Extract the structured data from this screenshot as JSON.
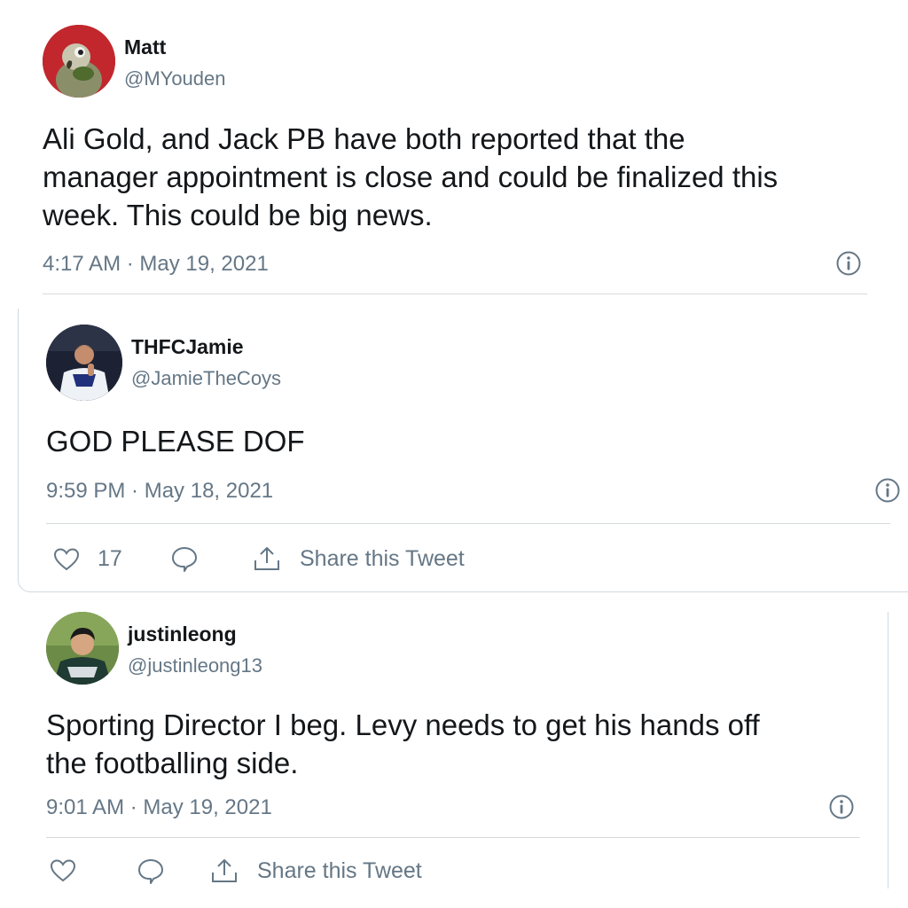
{
  "tweets": [
    {
      "author": "Matt",
      "handle": "@MYouden",
      "text_lines": [
        "Ali Gold, and Jack PB have both reported that the",
        "manager appointment is close and could be finalized this",
        "week. This could be big news."
      ],
      "timestamp": "4:17 AM · May 19, 2021",
      "avatar_icon": "parrot-avatar"
    },
    {
      "author": "THFCJamie",
      "handle": "@JamieTheCoys",
      "text_lines": [
        "GOD PLEASE DOF"
      ],
      "timestamp": "9:59 PM · May 18, 2021",
      "likes": "17",
      "share_label": "Share this Tweet",
      "avatar_icon": "footballer-avatar"
    },
    {
      "author": "justinleong",
      "handle": "@justinleong13",
      "text_lines": [
        "Sporting Director I beg. Levy needs to get his hands off",
        "the footballing side."
      ],
      "timestamp": "9:01 AM · May 19, 2021",
      "share_label": "Share this Tweet",
      "avatar_icon": "footballer-avatar"
    }
  ],
  "colors": {
    "text": "#14171a",
    "secondary": "#657786",
    "divider": "#d6dadd"
  }
}
